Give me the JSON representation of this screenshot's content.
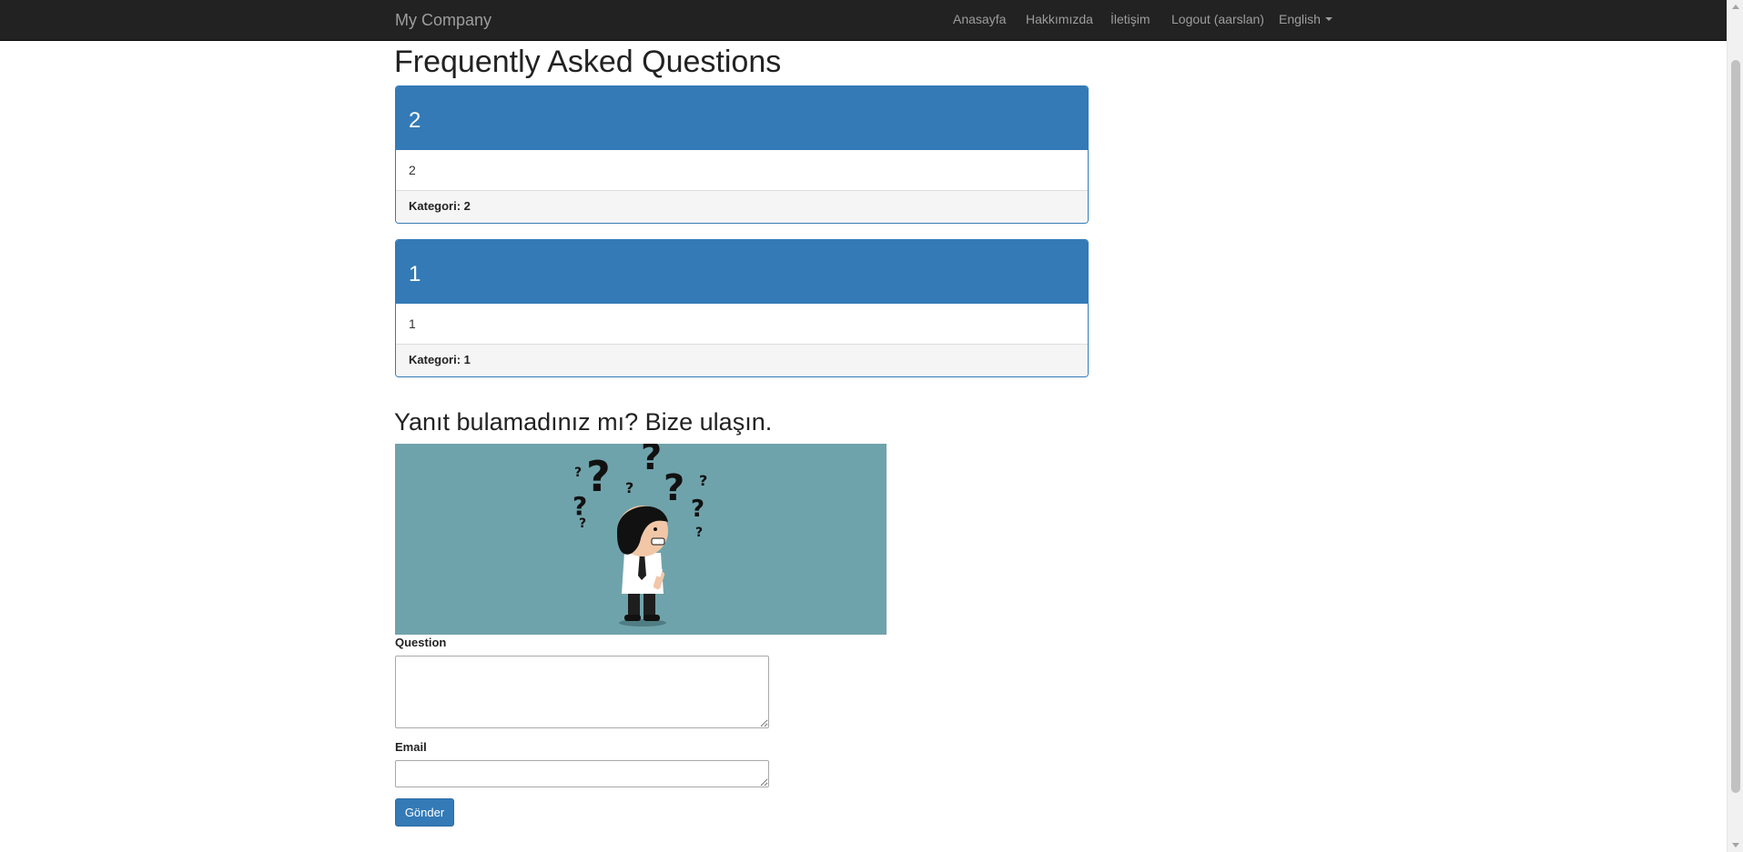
{
  "navbar": {
    "brand": "My Company",
    "links": [
      "Anasayfa",
      "Hakkımızda",
      "İletişim",
      "Logout (aarslan)"
    ],
    "language": "English"
  },
  "page_title": "Frequently Asked Questions",
  "faqs": [
    {
      "question": "2",
      "answer": "2",
      "category": "Kategori: 2"
    },
    {
      "question": "1",
      "answer": "1",
      "category": "Kategori: 1"
    }
  ],
  "contact": {
    "heading": "Yanıt bulamadınız mı? Bize ulaşın.",
    "image_icon": "confused-person-with-question-marks",
    "question_label": "Question",
    "email_label": "Email",
    "submit_label": "Gönder"
  },
  "colors": {
    "navbar_bg": "#222222",
    "primary": "#337ab7",
    "image_bg": "#6fa3ab"
  }
}
